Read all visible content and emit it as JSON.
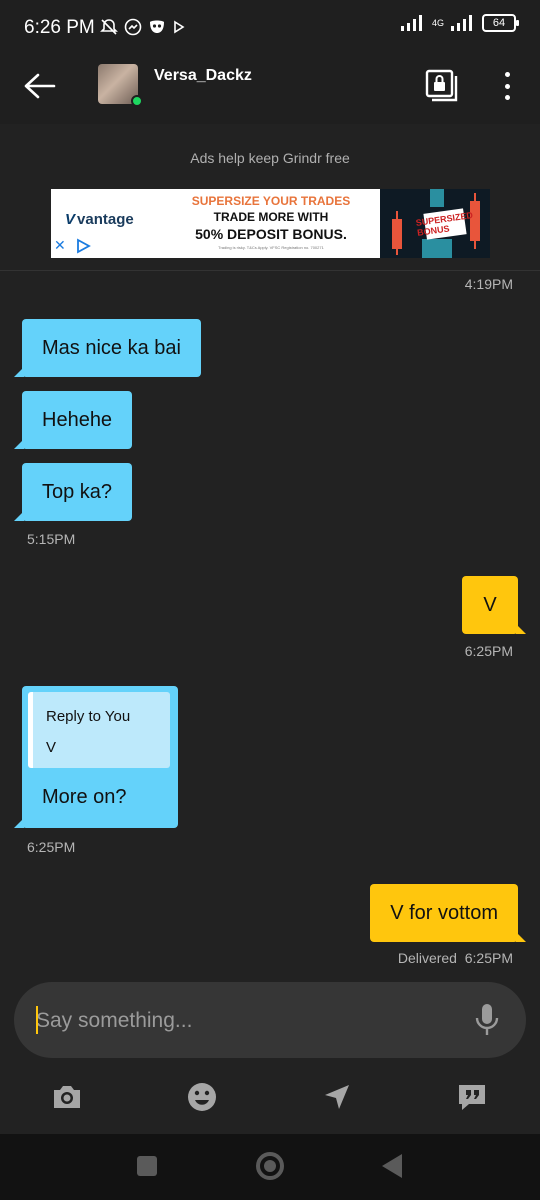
{
  "status_bar": {
    "time": "6:26 PM",
    "network": "4G",
    "battery": "64"
  },
  "header": {
    "username": "Versa_Dackz",
    "online": true
  },
  "ad": {
    "notice": "Ads help keep Grindr free",
    "brand": "vantage",
    "line1": "SUPERSIZE YOUR TRADES",
    "line2": "TRADE MORE WITH",
    "line3": "50% DEPOSIT BONUS.",
    "fineprint": "Trading is risky. T&Cs Apply. VFSC Registration no. 700271",
    "badge": "SUPERSIZED BONUS"
  },
  "messages": [
    {
      "type": "timestamp",
      "side": "right",
      "text": "4:19PM"
    },
    {
      "type": "in",
      "text": "Mas nice ka bai"
    },
    {
      "type": "in",
      "text": "Hehehe"
    },
    {
      "type": "in",
      "text": "Top ka?"
    },
    {
      "type": "timestamp",
      "side": "left",
      "text": "5:15PM"
    },
    {
      "type": "out",
      "text": "V"
    },
    {
      "type": "timestamp",
      "side": "right",
      "text": "6:25PM"
    },
    {
      "type": "in_reply",
      "reply_title": "Reply to You",
      "reply_body": "V",
      "text": "More on?"
    },
    {
      "type": "timestamp",
      "side": "left",
      "text": "6:25PM"
    },
    {
      "type": "out",
      "text": "V for vottom"
    },
    {
      "type": "timestamp",
      "side": "right",
      "text": "Delivered  6:25PM"
    }
  ],
  "composer": {
    "placeholder": "Say something..."
  },
  "toolbar": {
    "icons": [
      "camera-icon",
      "emoji-icon",
      "location-icon",
      "saved-phrases-icon"
    ]
  },
  "colors": {
    "background": "#222222",
    "incoming_bubble": "#64d2fa",
    "outgoing_bubble": "#ffc60d",
    "online_dot": "#1ed760"
  }
}
